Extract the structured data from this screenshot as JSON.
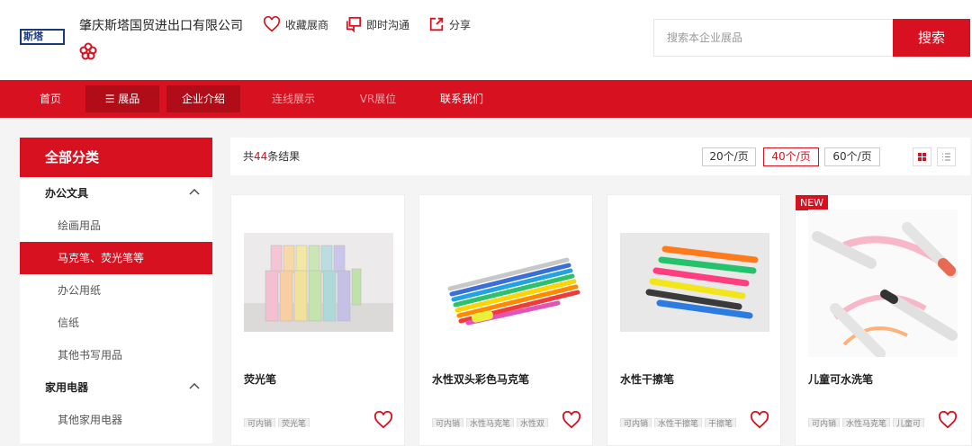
{
  "header": {
    "logo_text": "斯塔",
    "company": "肇庆斯塔国贸进出口有限公司",
    "actions": [
      {
        "label": "收藏展商",
        "icon": "heart-icon"
      },
      {
        "label": "即时沟通",
        "icon": "chat-icon"
      },
      {
        "label": "分享",
        "icon": "share-icon"
      }
    ],
    "search_placeholder": "搜索本企业展品",
    "search_button": "搜索"
  },
  "nav": [
    "首页",
    "☰ 展品",
    "企业介绍",
    "连线展示",
    "VR展位",
    "联系我们"
  ],
  "sidebar": {
    "title": "全部分类",
    "cat1": "办公文具",
    "cat1_items": [
      "绘画用品",
      "马克笔、荧光笔等",
      "办公用纸",
      "信纸",
      "其他书写用品"
    ],
    "cat2": "家用电器",
    "cat2_items": [
      "其他家用电器"
    ],
    "chevron": "^"
  },
  "results": {
    "prefix": "共",
    "count": "44",
    "suffix": "条结果",
    "per_page": [
      "20个/页",
      "40个/页",
      "60个/页"
    ],
    "active_per_page": "40个/页"
  },
  "products": [
    {
      "title": "荧光笔",
      "tags": [
        "可内销",
        "荧光笔"
      ],
      "new": false
    },
    {
      "title": "水性双头彩色马克笔",
      "tags": [
        "可内销",
        "水性马克笔",
        "水性双"
      ],
      "new": false
    },
    {
      "title": "水性干擦笔",
      "tags": [
        "可内销",
        "水性干擦笔",
        "干擦笔"
      ],
      "new": false
    },
    {
      "title": "儿童可水洗笔",
      "tags": [
        "可内销",
        "水性马克笔",
        "儿童可"
      ],
      "new": true,
      "badge": "NEW"
    }
  ],
  "colors": {
    "accent": "#d7111f",
    "accent_dark": "#b00d19"
  }
}
